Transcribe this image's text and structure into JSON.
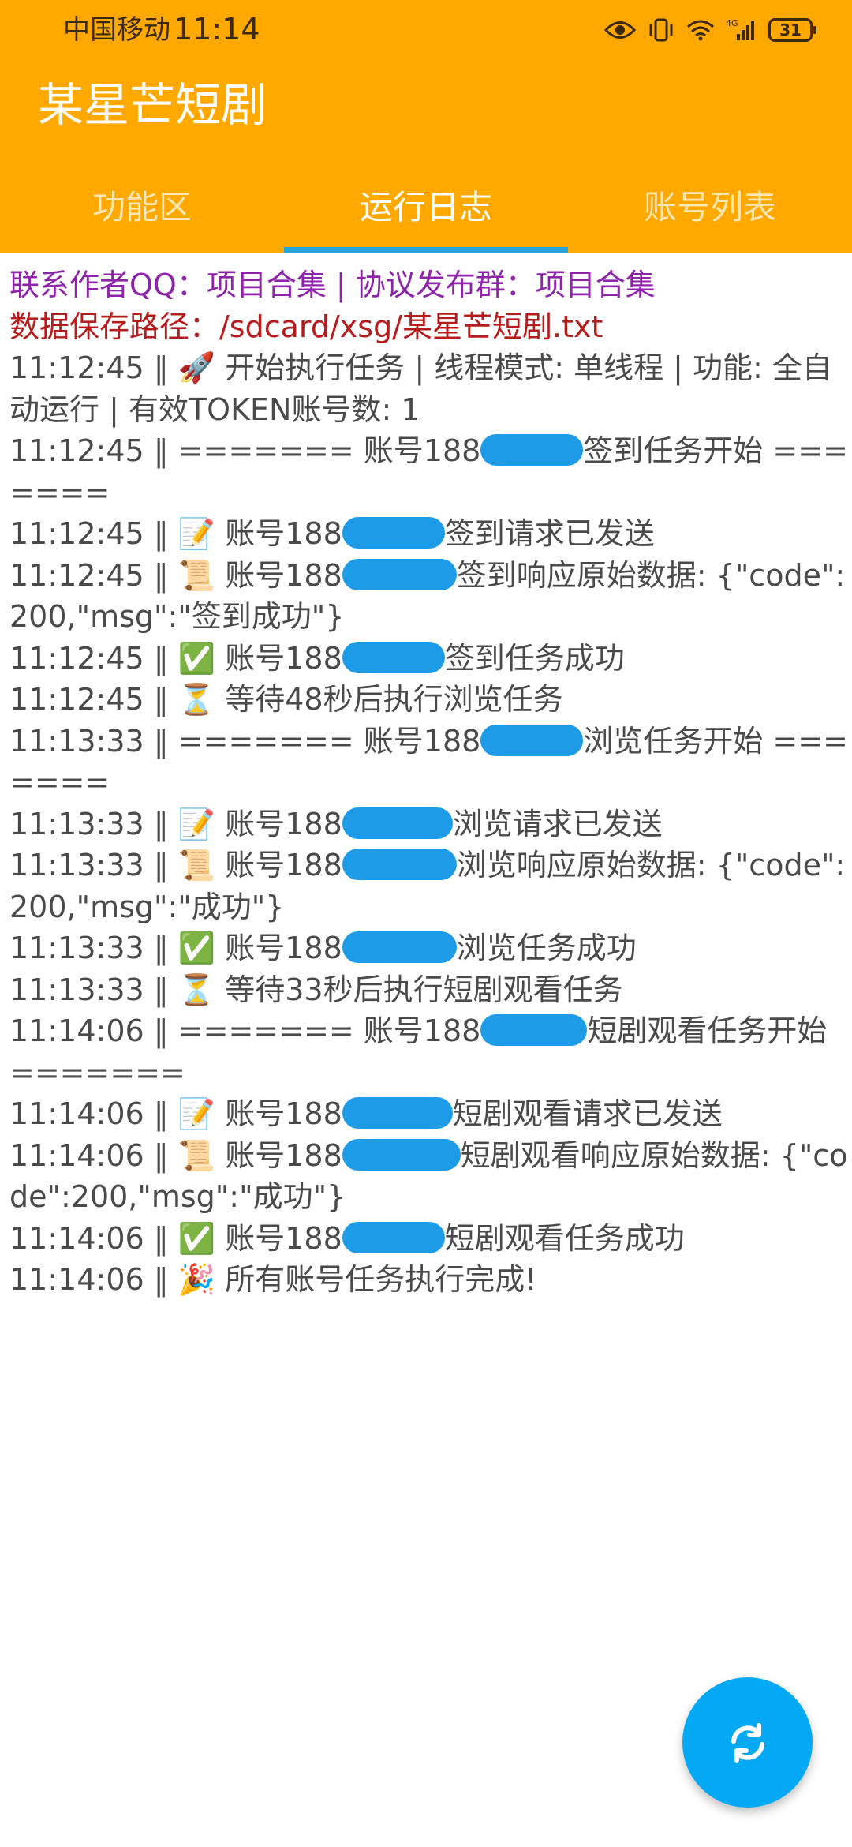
{
  "status_bar": {
    "carrier": "中国移动",
    "time": "11:14",
    "network_label": "4G",
    "battery": "31"
  },
  "app": {
    "title": "某星芒短剧"
  },
  "tabs": [
    {
      "label": "功能区",
      "active": false
    },
    {
      "label": "运行日志",
      "active": true
    },
    {
      "label": "账号列表",
      "active": false
    }
  ],
  "log": {
    "contact": "联系作者QQ：项目合集 | 协议发布群：项目合集",
    "path": "数据保存路径：/sdcard/xsg/某星芒短剧.txt",
    "entries": [
      {
        "ts": "11:12:45",
        "icon": "🚀",
        "a": "开始执行任务 | 线程模式: 单线程 | 功能: 全自动运行 | 有效TOKEN账号数: 1"
      },
      {
        "ts": "11:12:45",
        "icon": "",
        "a": "======= 账号188",
        "b": "签到任务开始 ======="
      },
      {
        "ts": "11:12:45",
        "icon": "📝",
        "a": "账号188",
        "b": "签到请求已发送"
      },
      {
        "ts": "11:12:45",
        "icon": "📜",
        "a": "账号188",
        "b": "签到响应原始数据: {\"code\":200,\"msg\":\"签到成功\"}"
      },
      {
        "ts": "11:12:45",
        "icon": "✅",
        "a": "账号188",
        "b": "签到任务成功"
      },
      {
        "ts": "11:12:45",
        "icon": "⏳",
        "a": "等待48秒后执行浏览任务"
      },
      {
        "ts": "11:13:33",
        "icon": "",
        "a": "======= 账号188",
        "b": "浏览任务开始 ======="
      },
      {
        "ts": "11:13:33",
        "icon": "📝",
        "a": "账号188",
        "b": "浏览请求已发送"
      },
      {
        "ts": "11:13:33",
        "icon": "📜",
        "a": "账号188",
        "b": "浏览响应原始数据: {\"code\":200,\"msg\":\"成功\"}"
      },
      {
        "ts": "11:13:33",
        "icon": "✅",
        "a": "账号188",
        "b": "浏览任务成功"
      },
      {
        "ts": "11:13:33",
        "icon": "⏳",
        "a": "等待33秒后执行短剧观看任务"
      },
      {
        "ts": "11:14:06",
        "icon": "",
        "a": "======= 账号188",
        "b": "短剧观看任务开始 ======="
      },
      {
        "ts": "11:14:06",
        "icon": "📝",
        "a": "账号188",
        "b": "短剧观看请求已发送"
      },
      {
        "ts": "11:14:06",
        "icon": "📜",
        "a": "账号188",
        "b": "短剧观看响应原始数据: {\"code\":200,\"msg\":\"成功\"}"
      },
      {
        "ts": "11:14:06",
        "icon": "✅",
        "a": "账号188",
        "b": "短剧观看任务成功"
      },
      {
        "ts": "11:14:06",
        "icon": "🎉",
        "a": "所有账号任务执行完成!"
      }
    ],
    "separator": "‖"
  },
  "fab": {
    "icon": "refresh-icon",
    "color": "#03A9F4"
  },
  "colors": {
    "appbar": "#FFA800",
    "tab_indicator": "#29A3D9",
    "contact_text": "#8E24AA",
    "path_text": "#B71C1C",
    "redaction": "#1E9BE6"
  }
}
